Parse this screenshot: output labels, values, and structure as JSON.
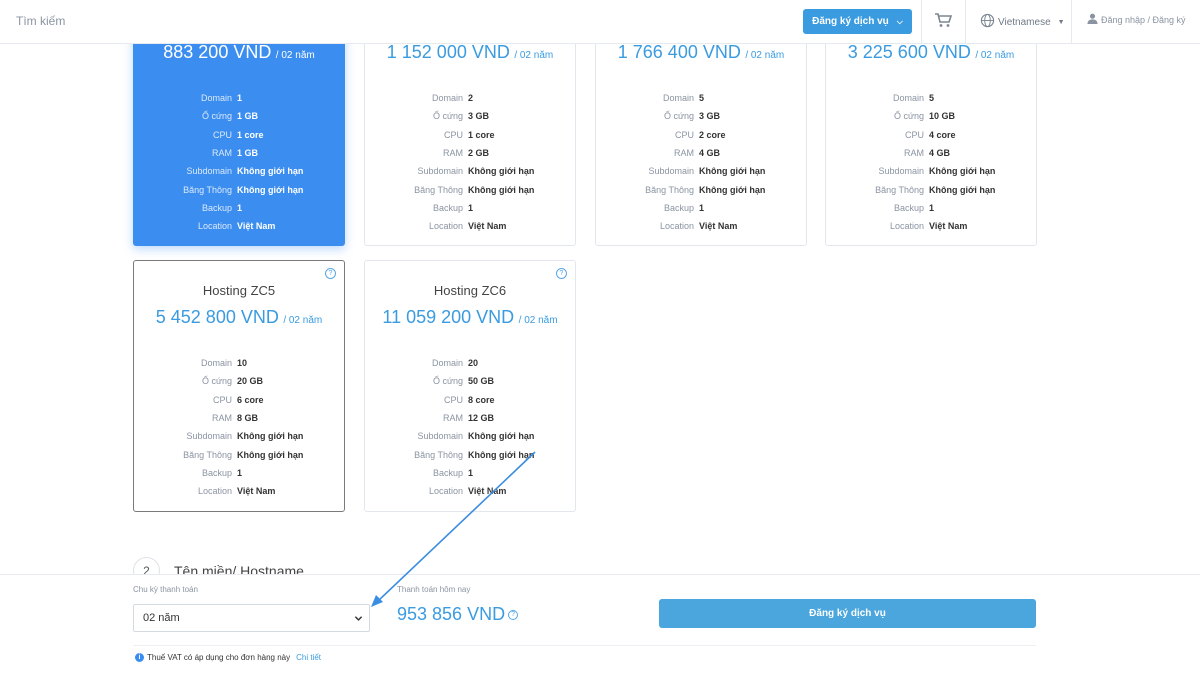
{
  "header": {
    "search_label": "Tìm kiếm",
    "register_button": "Đăng ký dịch vụ",
    "language": "Vietnamese",
    "login": "Đăng nhập / Đăng ký"
  },
  "spec_labels": {
    "domain": "Domain",
    "disk": "Ổ cứng",
    "cpu": "CPU",
    "ram": "RAM",
    "subdomain": "Subdomain",
    "bandwidth": "Băng Thông",
    "backup": "Backup",
    "location": "Location"
  },
  "plans": [
    {
      "price": "883 200 VND",
      "period": "/ 02 năm",
      "domain": "1",
      "disk": "1 GB",
      "cpu": "1 core",
      "ram": "1 GB",
      "subdomain": "Không giới hạn",
      "bandwidth": "Không giới hạn",
      "backup": "1",
      "location": "Việt Nam"
    },
    {
      "price": "1 152 000 VND",
      "period": "/ 02 năm",
      "domain": "2",
      "disk": "3 GB",
      "cpu": "1 core",
      "ram": "2 GB",
      "subdomain": "Không giới hạn",
      "bandwidth": "Không giới hạn",
      "backup": "1",
      "location": "Việt Nam"
    },
    {
      "price": "1 766 400 VND",
      "period": "/ 02 năm",
      "domain": "5",
      "disk": "3 GB",
      "cpu": "2 core",
      "ram": "4 GB",
      "subdomain": "Không giới hạn",
      "bandwidth": "Không giới hạn",
      "backup": "1",
      "location": "Việt Nam"
    },
    {
      "price": "3 225 600 VND",
      "period": "/ 02 năm",
      "domain": "5",
      "disk": "10 GB",
      "cpu": "4 core",
      "ram": "4 GB",
      "subdomain": "Không giới hạn",
      "bandwidth": "Không giới hạn",
      "backup": "1",
      "location": "Việt Nam"
    },
    {
      "name": "Hosting ZC5",
      "help": "?",
      "price": "5 452 800 VND",
      "period": "/ 02 năm",
      "domain": "10",
      "disk": "20 GB",
      "cpu": "6 core",
      "ram": "8 GB",
      "subdomain": "Không giới hạn",
      "bandwidth": "Không giới hạn",
      "backup": "1",
      "location": "Việt Nam"
    },
    {
      "name": "Hosting ZC6",
      "help": "?",
      "price": "11 059 200 VND",
      "period": "/ 02 năm",
      "domain": "20",
      "disk": "50 GB",
      "cpu": "8 core",
      "ram": "12 GB",
      "subdomain": "Không giới hạn",
      "bandwidth": "Không giới hạn",
      "backup": "1",
      "location": "Việt Nam"
    }
  ],
  "step": {
    "number": "2",
    "title": "Tên miền/ Hostname"
  },
  "checkout": {
    "cycle_label": "Chu kỳ thanh toán",
    "cycle_value": "02 năm",
    "today_label": "Thanh toán hôm nay",
    "today_amount": "953 856 VND",
    "help": "?",
    "submit_button": "Đăng ký dịch vụ",
    "vat_note": "Thuế VAT có áp dụng cho đơn hàng này",
    "vat_link": "Chi tiết",
    "info_mark": "i"
  },
  "colors": {
    "accent": "#3a9be0",
    "active_card": "#3b8ef0",
    "annotation_arrow": "#3a8de0"
  }
}
